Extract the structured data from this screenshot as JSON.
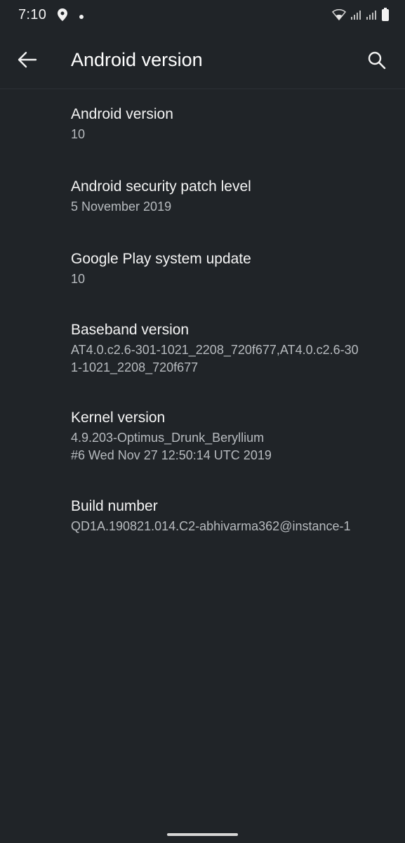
{
  "status_bar": {
    "time": "7:10",
    "left_icons": [
      "location-icon",
      "notification-dot-icon"
    ],
    "right_icons": [
      "wifi-icon",
      "signal-icon",
      "signal-icon",
      "battery-icon"
    ]
  },
  "app_bar": {
    "title": "Android version",
    "back_icon": "arrow-left-icon",
    "search_icon": "search-icon"
  },
  "items": [
    {
      "title": "Android version",
      "value": "10"
    },
    {
      "title": "Android security patch level",
      "value": "5 November 2019"
    },
    {
      "title": "Google Play system update",
      "value": "10"
    },
    {
      "title": "Baseband version",
      "value": "AT4.0.c2.6-301-1021_2208_720f677,AT4.0.c2.6-30\n1-1021_2208_720f677"
    },
    {
      "title": "Kernel version",
      "value": "4.9.203-Optimus_Drunk_Beryllium\n#6 Wed Nov 27 12:50:14 UTC 2019"
    },
    {
      "title": "Build number",
      "value": "QD1A.190821.014.C2-abhivarma362@instance-1"
    }
  ],
  "colors": {
    "background": "#202428",
    "title_text": "#f4f4f4",
    "secondary_text": "#b7bbbf"
  }
}
